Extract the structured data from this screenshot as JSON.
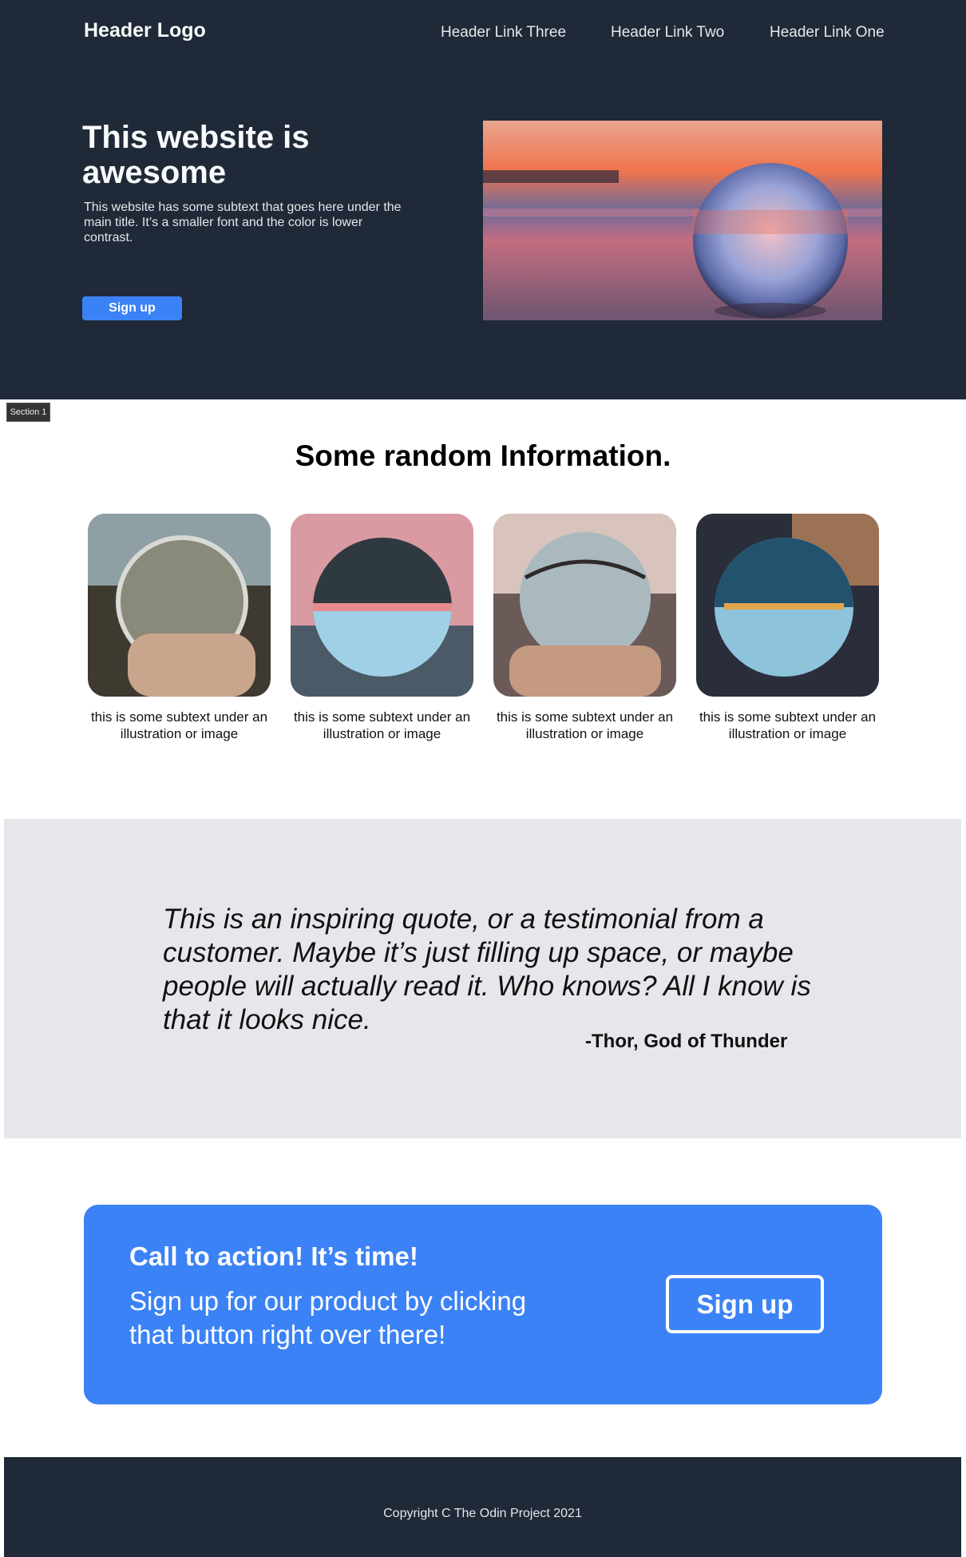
{
  "header": {
    "logo": "Header Logo",
    "links": [
      "Header Link Three",
      "Header Link Two",
      "Header Link One"
    ]
  },
  "hero": {
    "title": "This website is awesome",
    "subtext": "This website has some subtext that goes here under the main title. It’s a smaller font and the color is lower contrast.",
    "button_label": "Sign up",
    "image": "crystal-ball-on-beach-at-sunset"
  },
  "section_tag": "Section 1",
  "info": {
    "title": "Some random Information.",
    "cards": [
      {
        "text": "this is some subtext under an illustration or image",
        "image": "crystal-ball-forest"
      },
      {
        "text": "this is some subtext under an illustration or image",
        "image": "crystal-ball-sunset-trees"
      },
      {
        "text": "this is some subtext under an illustration or image",
        "image": "crystal-ball-branches"
      },
      {
        "text": "this is some subtext under an illustration or image",
        "image": "crystal-ball-bridge"
      }
    ]
  },
  "quote": {
    "text": "This is an inspiring quote, or a testimonial from a customer. Maybe it’s just filling up space, or maybe people will actually read it. Who knows? All I know is that it looks nice.",
    "author": "-Thor, God of Thunder"
  },
  "cta": {
    "title": "Call to action! It’s time!",
    "text": "Sign up for our product by clicking that button right over there!",
    "button_label": "Sign up"
  },
  "footer": {
    "copyright": "Copyright C The Odin Project 2021"
  },
  "colors": {
    "dark": "#1f2937",
    "accent": "#3b82f6",
    "quote_bg": "#e5e7eb"
  }
}
